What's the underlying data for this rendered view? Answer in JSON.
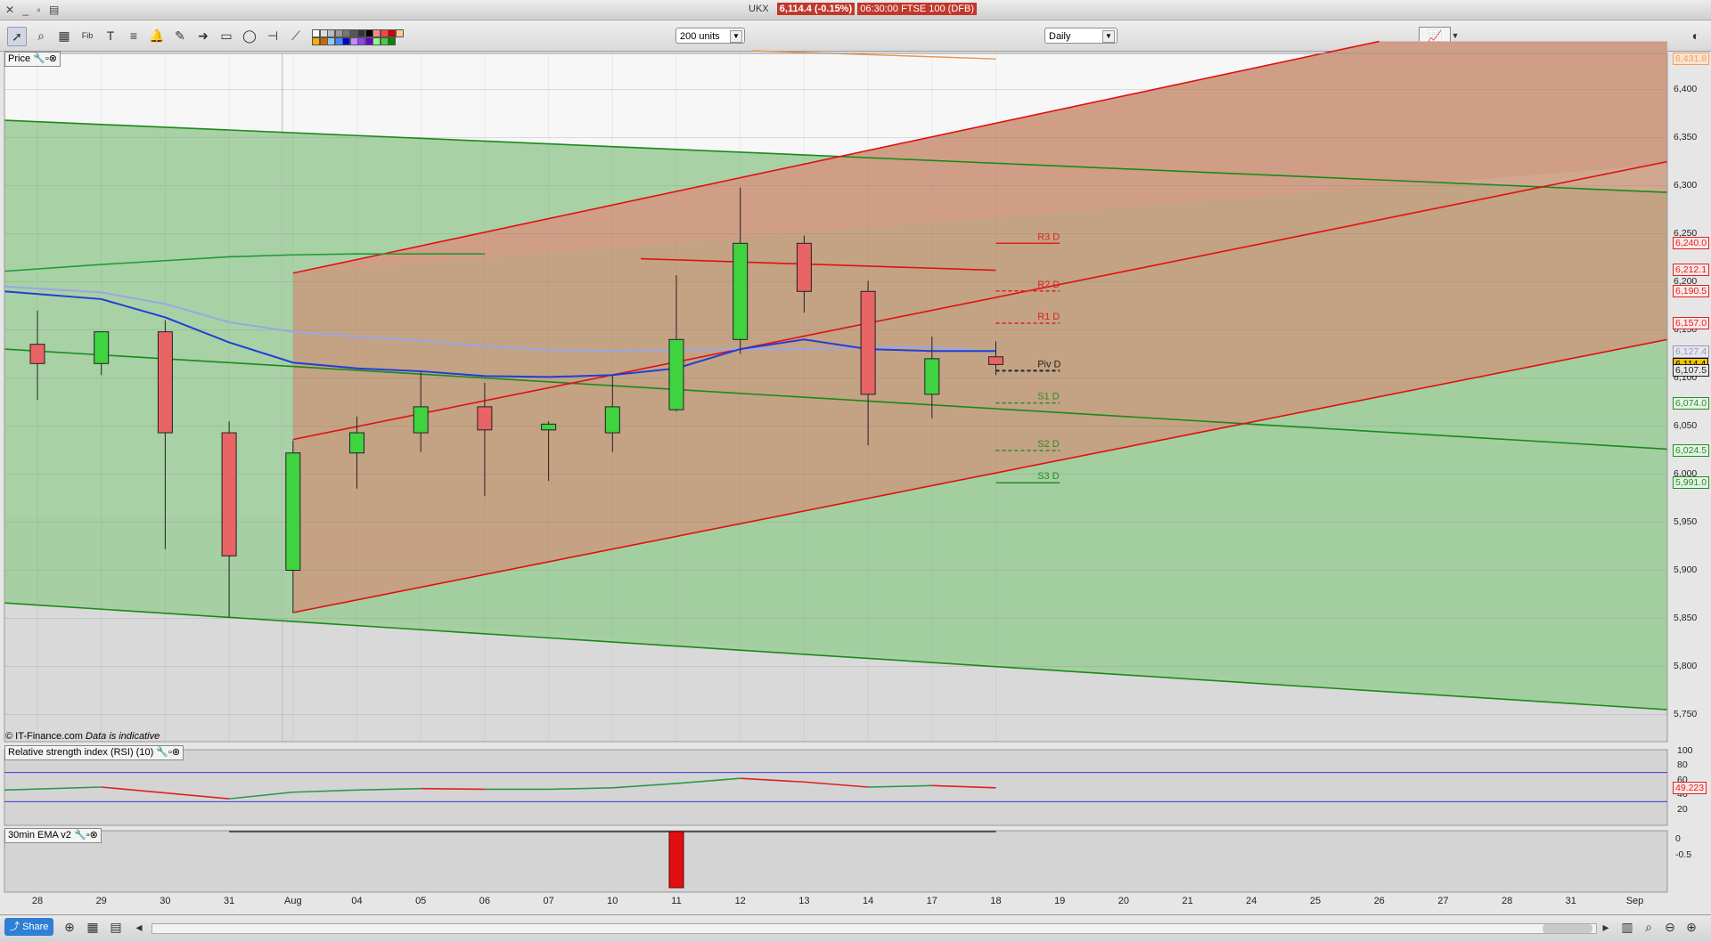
{
  "titlebar": {
    "symbol": "UKX",
    "price_change": "6,114.4 (-0.15%)",
    "datetime_market": "06:30:00 FTSE 100 (DFB)"
  },
  "toolbar": {
    "units_value": "200 units",
    "interval_value": "Daily"
  },
  "panels": {
    "price_label": "Price",
    "rsi_label": "Relative strength index (RSI) (10)",
    "ema_label": "30min EMA v2",
    "copyright": "© IT-Finance.com",
    "disclaimer": "Data is indicative"
  },
  "price_axis": {
    "ticks": [
      {
        "label": "6,400",
        "value": 6400
      },
      {
        "label": "6,350",
        "value": 6350
      },
      {
        "label": "6,300",
        "value": 6300
      },
      {
        "label": "6,250",
        "value": 6250
      },
      {
        "label": "6,200",
        "value": 6200
      },
      {
        "label": "6,150",
        "value": 6150
      },
      {
        "label": "6,100",
        "value": 6100
      },
      {
        "label": "6,050",
        "value": 6050
      },
      {
        "label": "6,000",
        "value": 6000
      },
      {
        "label": "5,950",
        "value": 5950
      },
      {
        "label": "5,900",
        "value": 5900
      },
      {
        "label": "5,850",
        "value": 5850
      },
      {
        "label": "5,800",
        "value": 5800
      },
      {
        "label": "5,750",
        "value": 5750
      }
    ],
    "tags": [
      {
        "label": "6,431.8",
        "value": 6431.8,
        "color": "#e8a06a",
        "bg": "#fde3cc"
      },
      {
        "label": "6,240.0",
        "value": 6240,
        "color": "#d22",
        "bg": "#fde6e6"
      },
      {
        "label": "6,212.1",
        "value": 6212.1,
        "color": "#d22",
        "bg": "#fde6e6"
      },
      {
        "label": "6,190.5",
        "value": 6190.5,
        "color": "#d22",
        "bg": "#fde6e6"
      },
      {
        "label": "6,157.0",
        "value": 6157,
        "color": "#d22",
        "bg": "#fde6e6"
      },
      {
        "label": "6,127.4",
        "value": 6127.4,
        "color": "#99a",
        "bg": "#e6e6f4"
      },
      {
        "label": "6,114.4",
        "value": 6114.4,
        "color": "#000",
        "bg": "#f4c400"
      },
      {
        "label": "6,107.5",
        "value": 6107.5,
        "color": "#222",
        "bg": "#e6e6e6"
      },
      {
        "label": "6,074.0",
        "value": 6074,
        "color": "#2a8a2a",
        "bg": "#e4f4e4"
      },
      {
        "label": "6,024.5",
        "value": 6024.5,
        "color": "#2a8a2a",
        "bg": "#e4f4e4"
      },
      {
        "label": "5,991.0",
        "value": 5991,
        "color": "#2a8a2a",
        "bg": "#e4f4e4"
      }
    ]
  },
  "dates": [
    {
      "label": "28",
      "i": 0
    },
    {
      "label": "29",
      "i": 1
    },
    {
      "label": "30",
      "i": 2
    },
    {
      "label": "31",
      "i": 3
    },
    {
      "label": "Aug",
      "i": 4
    },
    {
      "label": "04",
      "i": 5
    },
    {
      "label": "05",
      "i": 6
    },
    {
      "label": "06",
      "i": 7
    },
    {
      "label": "07",
      "i": 8
    },
    {
      "label": "10",
      "i": 9
    },
    {
      "label": "11",
      "i": 10
    },
    {
      "label": "12",
      "i": 11
    },
    {
      "label": "13",
      "i": 12
    },
    {
      "label": "14",
      "i": 13
    },
    {
      "label": "17",
      "i": 14
    },
    {
      "label": "18",
      "i": 15
    },
    {
      "label": "19",
      "i": 16
    },
    {
      "label": "20",
      "i": 17
    },
    {
      "label": "21",
      "i": 18
    },
    {
      "label": "24",
      "i": 19
    },
    {
      "label": "25",
      "i": 20
    },
    {
      "label": "26",
      "i": 21
    },
    {
      "label": "27",
      "i": 22
    },
    {
      "label": "28",
      "i": 23
    },
    {
      "label": "31",
      "i": 24
    },
    {
      "label": "Sep",
      "i": 25
    }
  ],
  "chart_data": {
    "type": "candlestick",
    "candles": [
      {
        "d": "28",
        "o": 6135,
        "h": 6170,
        "l": 6077,
        "c": 6115
      },
      {
        "d": "29",
        "o": 6115,
        "h": 6140,
        "l": 6103,
        "c": 6148
      },
      {
        "d": "30",
        "o": 6148,
        "h": 6160,
        "l": 5922,
        "c": 6043
      },
      {
        "d": "31",
        "o": 6043,
        "h": 6055,
        "l": 5851,
        "c": 5915
      },
      {
        "d": "Aug",
        "o": 5900,
        "h": 6035,
        "l": 5856,
        "c": 6022
      },
      {
        "d": "04",
        "o": 6022,
        "h": 6060,
        "l": 5985,
        "c": 6043
      },
      {
        "d": "05",
        "o": 6043,
        "h": 6106,
        "l": 6023,
        "c": 6070
      },
      {
        "d": "06",
        "o": 6070,
        "h": 6095,
        "l": 5977,
        "c": 6046
      },
      {
        "d": "07",
        "o": 6046,
        "h": 6055,
        "l": 5993,
        "c": 6052
      },
      {
        "d": "10",
        "o": 6043,
        "h": 6103,
        "l": 6023,
        "c": 6070
      },
      {
        "d": "11",
        "o": 6067,
        "h": 6207,
        "l": 6065,
        "c": 6140
      },
      {
        "d": "12",
        "o": 6140,
        "h": 6298,
        "l": 6125,
        "c": 6240
      },
      {
        "d": "13",
        "o": 6240,
        "h": 6248,
        "l": 6168,
        "c": 6190
      },
      {
        "d": "14",
        "o": 6190,
        "h": 6201,
        "l": 6030,
        "c": 6083
      },
      {
        "d": "17",
        "o": 6083,
        "h": 6143,
        "l": 6058,
        "c": 6120
      },
      {
        "d": "18",
        "o": 6122,
        "h": 6138,
        "l": 6103,
        "c": 6114
      }
    ],
    "ema_blue": [
      6190,
      6182,
      6163,
      6137,
      6116,
      6110,
      6107,
      6102,
      6101,
      6103,
      6110,
      6130,
      6140,
      6130,
      6128,
      6128
    ],
    "ema_light": [
      6195,
      6189,
      6177,
      6158,
      6148,
      6143,
      6139,
      6133,
      6129,
      6128,
      6129,
      6130,
      6130,
      6132,
      6132,
      6127
    ],
    "red_ma": {
      "start": [
        10,
        6224
      ],
      "end": [
        15,
        6212
      ]
    },
    "green_ma": [
      [
        0,
        6211
      ],
      [
        1,
        6218
      ],
      [
        2,
        6222
      ],
      [
        3,
        6226
      ],
      [
        4,
        6228
      ],
      [
        5,
        6229
      ],
      [
        6,
        6229
      ],
      [
        7,
        6229
      ]
    ],
    "pivots": [
      {
        "label": "R3 D",
        "value": 6240,
        "color": "#d22",
        "dash": false
      },
      {
        "label": "R2 D",
        "value": 6190.5,
        "color": "#d22",
        "dash": true
      },
      {
        "label": "R1 D",
        "value": 6157,
        "color": "#d22",
        "dash": true
      },
      {
        "label": "Piv D",
        "value": 6107.5,
        "color": "#222",
        "dash": true
      },
      {
        "label": "S1 D",
        "value": 6074,
        "color": "#2a8a2a",
        "dash": true
      },
      {
        "label": "S2 D",
        "value": 6024.5,
        "color": "#2a8a2a",
        "dash": true
      },
      {
        "label": "S3 D",
        "value": 5991,
        "color": "#2a8a2a",
        "dash": false
      }
    ],
    "rsi": {
      "values": [
        46,
        50,
        42,
        34,
        43,
        46,
        48,
        47,
        47,
        49,
        55,
        62,
        57,
        50,
        52,
        49
      ],
      "axis": [
        {
          "label": "100",
          "v": 100
        },
        {
          "label": "80",
          "v": 80
        },
        {
          "label": "60",
          "v": 60
        },
        {
          "label": "40",
          "v": 40
        },
        {
          "label": "20",
          "v": 20
        }
      ],
      "last_label": "49.223"
    },
    "ema_indicator": {
      "axis": [
        {
          "label": "0",
          "v": 0
        },
        {
          "label": "-0.5",
          "v": -0.5
        }
      ]
    }
  },
  "bottom": {
    "share_label": "Share"
  }
}
